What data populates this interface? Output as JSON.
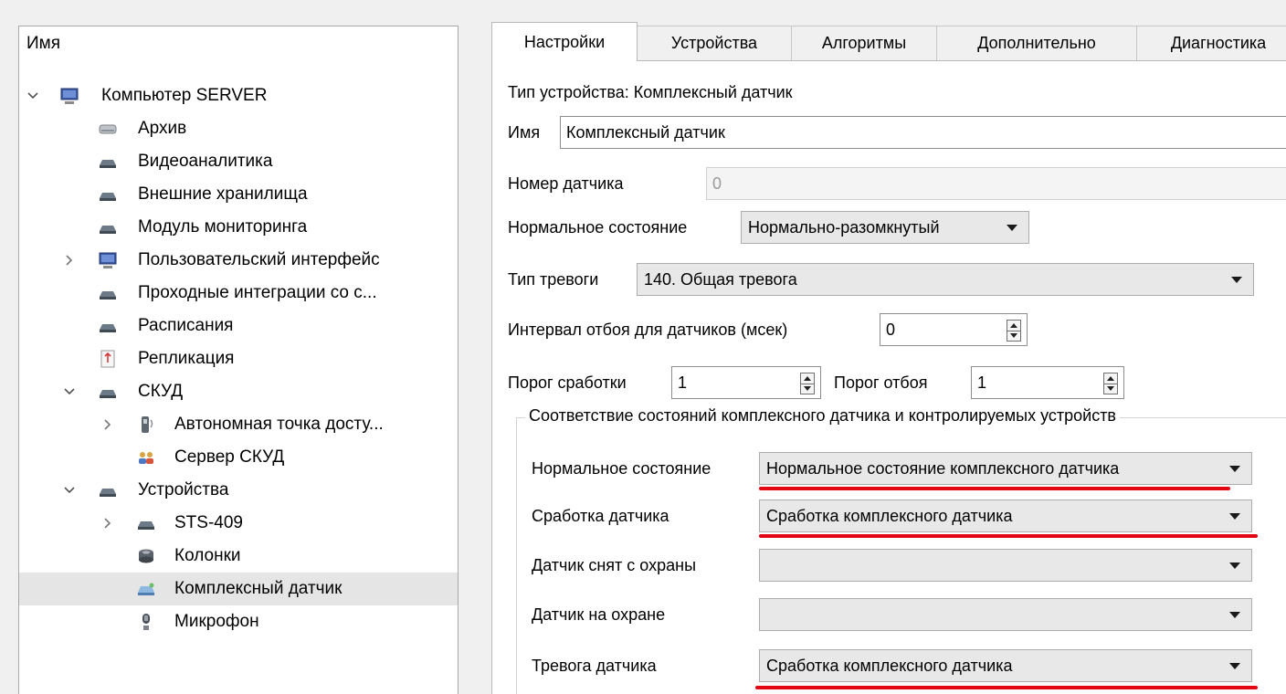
{
  "tree": {
    "header": "Имя",
    "items": [
      {
        "label": "Компьютер SERVER",
        "icon": "computer-icon",
        "chevron": "expanded"
      },
      {
        "label": "Архив",
        "icon": "hdd-icon",
        "chevron": "none"
      },
      {
        "label": "Видеоаналитика",
        "icon": "module-icon",
        "chevron": "none"
      },
      {
        "label": "Внешние хранилища",
        "icon": "module-icon",
        "chevron": "none"
      },
      {
        "label": "Модуль мониторинга",
        "icon": "module-icon",
        "chevron": "none"
      },
      {
        "label": "Пользовательский интерфейс",
        "icon": "monitor-icon",
        "chevron": "collapsed"
      },
      {
        "label": "Проходные интеграции со с...",
        "icon": "module-icon",
        "chevron": "none"
      },
      {
        "label": "Расписания",
        "icon": "module-icon",
        "chevron": "none"
      },
      {
        "label": "Репликация",
        "icon": "replication-icon",
        "chevron": "none"
      },
      {
        "label": "СКУД",
        "icon": "module-icon",
        "chevron": "expanded"
      },
      {
        "label": "Автономная точка досту...",
        "icon": "access-point-icon",
        "chevron": "collapsed"
      },
      {
        "label": "Сервер СКУД",
        "icon": "users-icon",
        "chevron": "none"
      },
      {
        "label": "Устройства",
        "icon": "module-icon",
        "chevron": "expanded"
      },
      {
        "label": "STS-409",
        "icon": "module-icon",
        "chevron": "collapsed"
      },
      {
        "label": "Колонки",
        "icon": "speaker-icon",
        "chevron": "none"
      },
      {
        "label": "Комплексный датчик",
        "icon": "complex-sensor-icon",
        "chevron": "none",
        "selected": true
      },
      {
        "label": "Микрофон",
        "icon": "microphone-icon",
        "chevron": "none"
      }
    ]
  },
  "tabs": [
    "Настройки",
    "Устройства",
    "Алгоритмы",
    "Дополнительно",
    "Диагностика"
  ],
  "active_tab": "Настройки",
  "settings": {
    "device_type": "Тип устройства: Комплексный датчик",
    "name_label": "Имя",
    "name_value": "Комплексный датчик",
    "sensor_number_label": "Номер датчика",
    "sensor_number_value": "0",
    "normal_state_label": "Нормальное состояние",
    "normal_state_value": "Нормально-разомкнутый",
    "alarm_type_label": "Тип тревоги",
    "alarm_type_value": "140. Общая тревога",
    "debounce_label": "Интервал отбоя для датчиков (мсек)",
    "debounce_value": "0",
    "trigger_threshold_label": "Порог сработки",
    "trigger_threshold_value": "1",
    "reset_threshold_label": "Порог отбоя",
    "reset_threshold_value": "1"
  },
  "mapping": {
    "title": "Соответствие состояний комплексного датчика и контролируемых устройств",
    "rows": [
      {
        "label": "Нормальное состояние",
        "value": "Нормальное состояние комплексного датчика",
        "highlighted": true
      },
      {
        "label": "Сработка датчика",
        "value": "Сработка комплексного датчика",
        "highlighted": true
      },
      {
        "label": "Датчик снят с охраны",
        "value": "",
        "highlighted": false
      },
      {
        "label": "Датчик на охране",
        "value": "",
        "highlighted": false
      },
      {
        "label": "Тревога датчика",
        "value": "Сработка комплексного датчика",
        "highlighted": true
      }
    ]
  },
  "colors": {
    "highlight_underline": "#e30613",
    "selection": "#e5e5e5"
  }
}
